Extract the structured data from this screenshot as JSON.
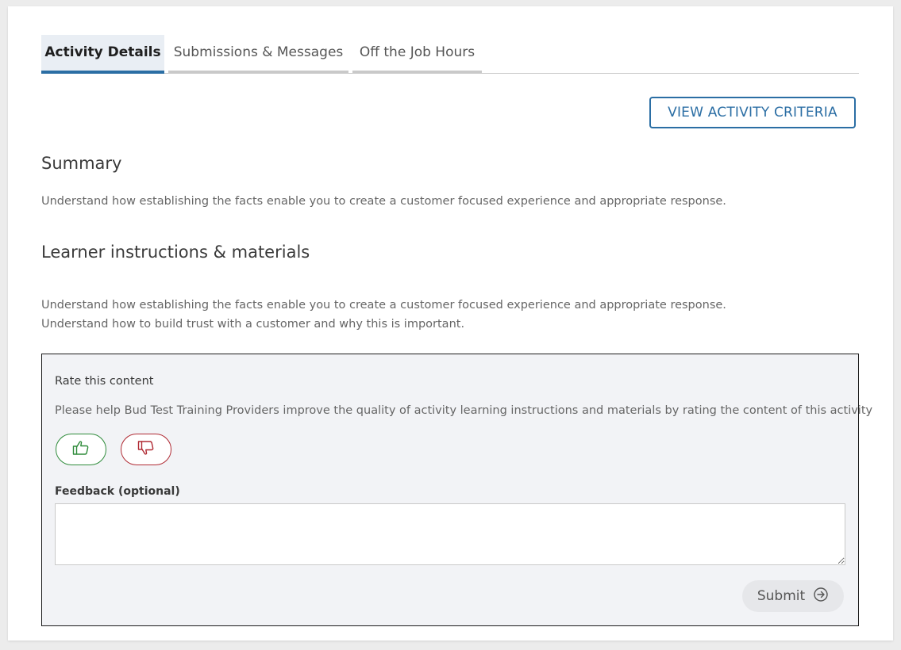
{
  "tabs": [
    {
      "label": "Activity Details",
      "active": true
    },
    {
      "label": "Submissions & Messages",
      "active": false
    },
    {
      "label": "Off the Job Hours",
      "active": false
    }
  ],
  "criteria_button": "VIEW ACTIVITY CRITERIA",
  "summary": {
    "title": "Summary",
    "text": "Understand how establishing the facts enable you to create a customer focused experience and appropriate response."
  },
  "learner": {
    "title": "Learner instructions & materials",
    "lines": [
      "Understand how establishing the facts enable you to create a customer focused experience and appropriate response.",
      "Understand how to build trust with a customer and why this is important."
    ]
  },
  "rating": {
    "title": "Rate this content",
    "description": "Please help Bud Test Training Providers improve the quality of activity learning instructions and materials by rating the content of this activity",
    "thumbs_up_icon": "thumbs-up-icon",
    "thumbs_down_icon": "thumbs-down-icon",
    "feedback_label": "Feedback (optional)",
    "feedback_value": "",
    "submit_label": "Submit",
    "submit_icon": "arrow-right-circle-icon"
  },
  "colors": {
    "accent": "#2b6ea4",
    "positive": "#2e8b3a",
    "negative": "#b02a33",
    "panel_bg": "#f2f3f6"
  }
}
